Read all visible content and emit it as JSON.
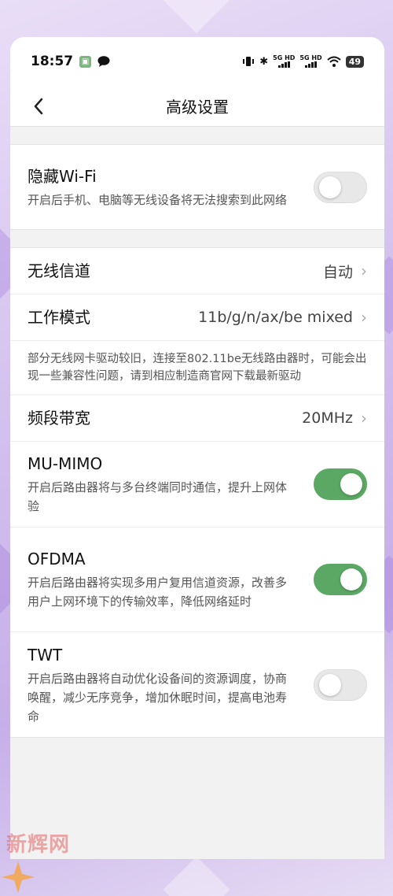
{
  "status_bar": {
    "time": "18:57",
    "badge_icon": "app-notification-icon",
    "message_icon": "chat-bubble-icon",
    "signal1_label": "5G HD",
    "signal2_label": "5G HD",
    "battery": "49"
  },
  "header": {
    "title": "高级设置",
    "back_icon": "back-arrow-icon"
  },
  "hidden_wifi": {
    "title": "隐藏Wi-Fi",
    "desc": "开启后手机、电脑等无线设备将无法搜索到此网络",
    "enabled": false
  },
  "channel": {
    "title": "无线信道",
    "value": "自动"
  },
  "mode": {
    "title": "工作模式",
    "value": "11b/g/n/ax/be mixed"
  },
  "mode_note": "部分无线网卡驱动较旧，连接至802.11be无线路由器时，可能会出现一些兼容性问题，请到相应制造商官网下载最新驱动",
  "bandwidth": {
    "title": "频段带宽",
    "value": "20MHz"
  },
  "mu_mimo": {
    "title": "MU-MIMO",
    "desc": "开启后路由器将与多台终端同时通信，提升上网体验",
    "enabled": true
  },
  "ofdma": {
    "title": "OFDMA",
    "desc": "开启后路由器将实现多用户复用信道资源，改善多用户上网环境下的传输效率，降低网络延时",
    "enabled": true
  },
  "twt": {
    "title": "TWT",
    "desc": "开启后路由器将自动优化设备间的资源调度，协商唤醒，减少无序竞争，增加休眠时间，提高电池寿命",
    "enabled": false
  },
  "watermark": "新辉网",
  "colors": {
    "toggle_on": "#5aa863",
    "toggle_off": "#e8e8e8"
  }
}
